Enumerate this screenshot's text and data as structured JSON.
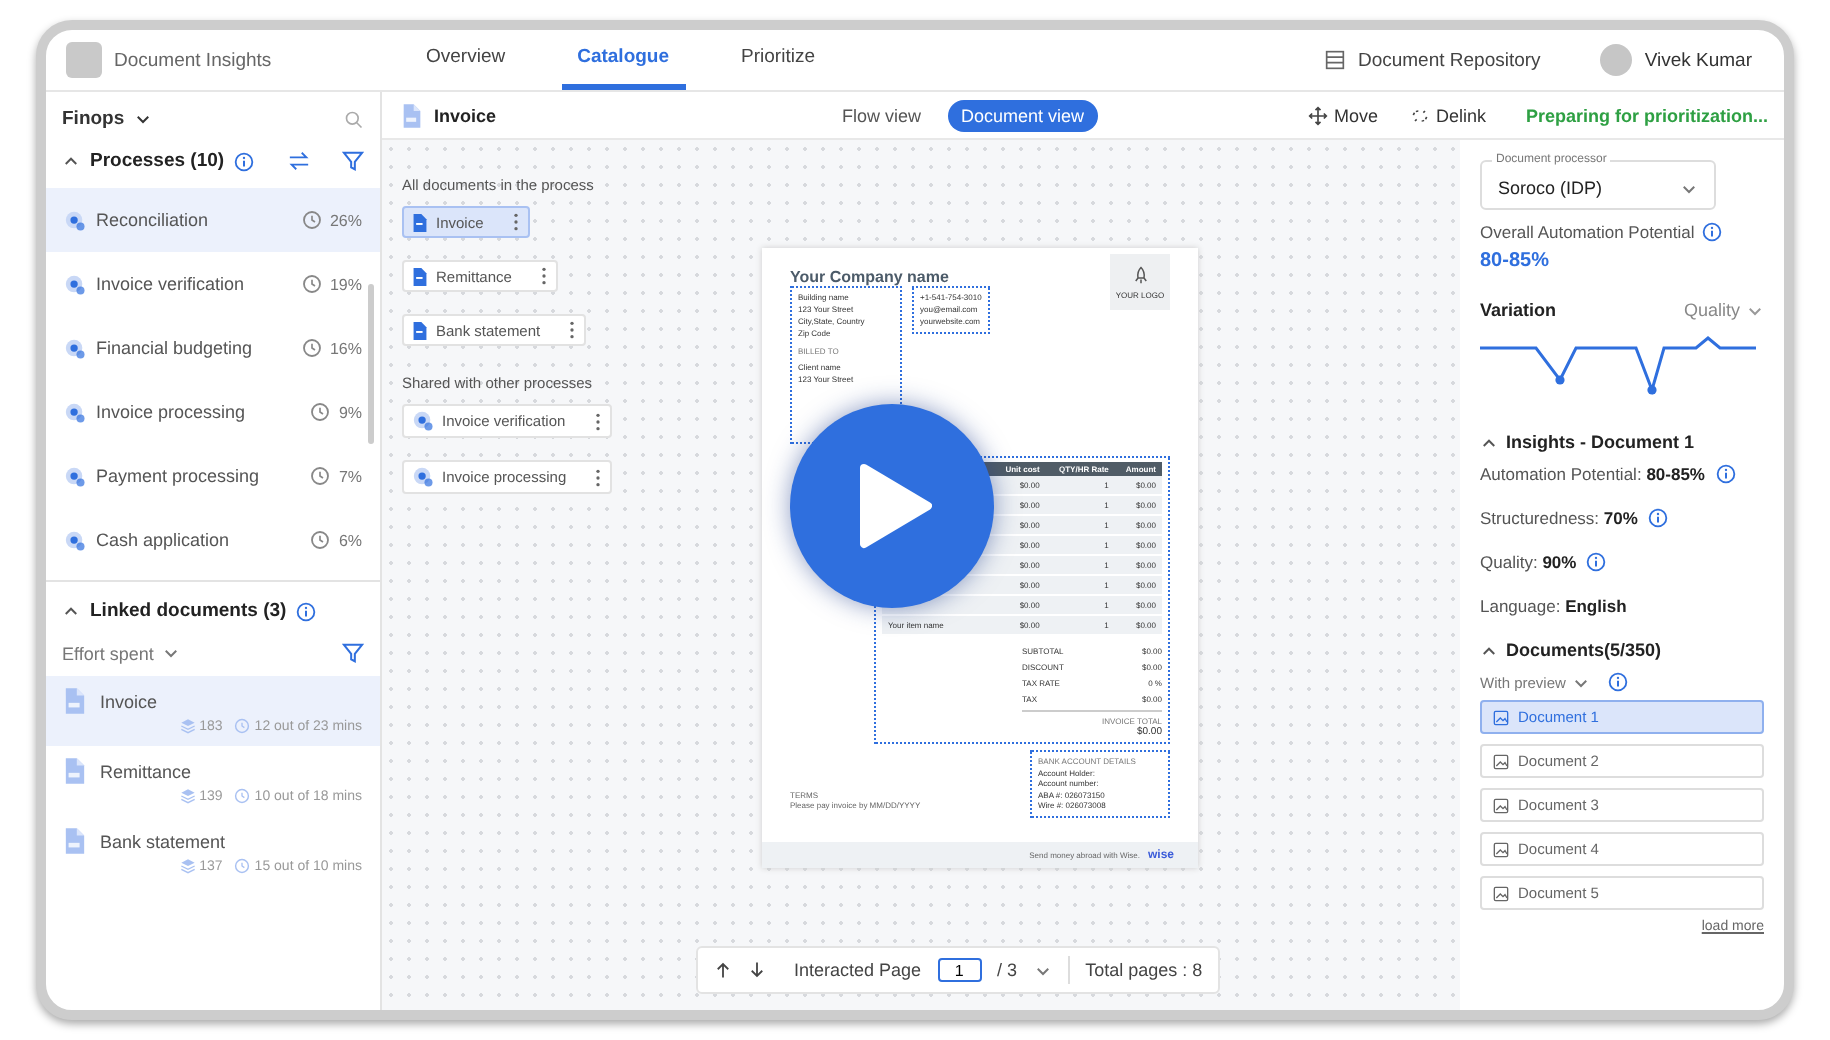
{
  "app": {
    "title": "Document Insights"
  },
  "nav_tabs": [
    {
      "label": "Overview",
      "selected": false
    },
    {
      "label": "Catalogue",
      "selected": true
    },
    {
      "label": "Prioritize",
      "selected": false
    }
  ],
  "repository_link": "Document Repository",
  "user": {
    "name": "Vivek Kumar"
  },
  "sidebar": {
    "workspace": "Finops",
    "processes": {
      "title": "Processes (10)",
      "expanded": true,
      "items": [
        {
          "name": "Reconciliation",
          "share": "26%",
          "selected": true
        },
        {
          "name": "Invoice verification",
          "share": "19%",
          "selected": false
        },
        {
          "name": "Financial budgeting",
          "share": "16%",
          "selected": false
        },
        {
          "name": "Invoice processing",
          "share": "9%",
          "selected": false
        },
        {
          "name": "Payment processing",
          "share": "7%",
          "selected": false
        },
        {
          "name": "Cash application",
          "share": "6%",
          "selected": false
        }
      ]
    },
    "linked_documents": {
      "title": "Linked documents (3)",
      "expanded": true,
      "sort": "Effort spent",
      "items": [
        {
          "name": "Invoice",
          "pages": "183",
          "effort": "12 out of 23 mins",
          "selected": true
        },
        {
          "name": "Remittance",
          "pages": "139",
          "effort": "10 out of 18 mins",
          "selected": false
        },
        {
          "name": "Bank statement",
          "pages": "137",
          "effort": "15 out of 10 mins",
          "selected": false
        }
      ]
    }
  },
  "toolbar": {
    "document": "Invoice",
    "views": [
      {
        "label": "Flow view",
        "selected": false
      },
      {
        "label": "Document view",
        "selected": true
      }
    ],
    "actions": [
      {
        "label": "Move",
        "kind": "move"
      },
      {
        "label": "Delink",
        "kind": "delink"
      }
    ],
    "status": "Preparing for prioritization..."
  },
  "canvas": {
    "groups": [
      {
        "title": "All documents in the process",
        "items": [
          {
            "label": "Invoice",
            "kind": "document",
            "selected": true
          },
          {
            "label": "Remittance",
            "kind": "document",
            "selected": false
          },
          {
            "label": "Bank statement",
            "kind": "document",
            "selected": false
          }
        ]
      },
      {
        "title": "Shared with other processes",
        "items": [
          {
            "label": "Invoice verification",
            "kind": "process",
            "selected": false
          },
          {
            "label": "Invoice processing",
            "kind": "process",
            "selected": false
          }
        ]
      }
    ]
  },
  "preview": {
    "company": "Your Company name",
    "address": [
      "Building name",
      "123 Your Street",
      "City,State, Country",
      "Zip Code"
    ],
    "contact": [
      "+1-541-754-3010",
      "you@email.com",
      "yourwebsite.com"
    ],
    "logo": "YOUR LOGO",
    "billed_to": {
      "title": "BILLED TO",
      "lines": [
        "Client name",
        "123 Your Street"
      ]
    },
    "table": {
      "columns": [
        "Unit cost",
        "QTY/HR Rate",
        "Amount"
      ],
      "rows": [
        {
          "unit_cost": "$0.00",
          "qty": "1",
          "amount": "$0.00"
        },
        {
          "unit_cost": "$0.00",
          "qty": "1",
          "amount": "$0.00"
        },
        {
          "unit_cost": "$0.00",
          "qty": "1",
          "amount": "$0.00"
        },
        {
          "unit_cost": "$0.00",
          "qty": "1",
          "amount": "$0.00"
        },
        {
          "unit_cost": "$0.00",
          "qty": "1",
          "amount": "$0.00"
        },
        {
          "unit_cost": "$0.00",
          "qty": "1",
          "amount": "$0.00"
        },
        {
          "unit_cost": "$0.00",
          "qty": "1",
          "amount": "$0.00"
        },
        {
          "item": "Your item name",
          "unit_cost": "$0.00",
          "qty": "1",
          "amount": "$0.00"
        }
      ]
    },
    "totals": [
      {
        "label": "SUBTOTAL",
        "value": "$0.00"
      },
      {
        "label": "DISCOUNT",
        "value": "$0.00"
      },
      {
        "label": "TAX RATE",
        "value": "0 %"
      },
      {
        "label": "TAX",
        "value": "$0.00"
      }
    ],
    "total": {
      "label": "INVOICE TOTAL",
      "value": "$0.00"
    },
    "bank": {
      "title": "BANK ACCOUNT DETAILS",
      "lines": [
        "Account Holder:",
        "Account number:",
        "ABA #: 026073150",
        "Wire #: 026073008"
      ]
    },
    "terms": {
      "title": "TERMS",
      "text": "Please pay invoice by MM/DD/YYYY"
    },
    "footer": {
      "text": "Send money abroad with Wise.",
      "brand": "wise"
    }
  },
  "pager": {
    "label": "Interacted Page",
    "page": "1",
    "of": "/ 3",
    "total": "Total pages : 8"
  },
  "right_panel": {
    "processor": {
      "label": "Document processor",
      "value": "Soroco (IDP)"
    },
    "potential_label": "Overall Automation Potential",
    "potential_value": "80-85%",
    "variation": {
      "title": "Variation",
      "metric": "Quality"
    },
    "insights": {
      "title": "Insights - Document 1",
      "expanded": true,
      "rows": [
        {
          "label": "Automation Potential:",
          "value": "80-85%",
          "info": true
        },
        {
          "label": "Structuredness:",
          "value": "70%",
          "info": true
        },
        {
          "label": "Quality:",
          "value": "90%",
          "info": true
        },
        {
          "label": "Language:",
          "value": "English",
          "info": false
        }
      ]
    },
    "documents": {
      "title": "Documents(5/350)",
      "expanded": true,
      "filter": "With preview",
      "items": [
        {
          "label": "Document 1",
          "selected": true
        },
        {
          "label": "Document 2",
          "selected": false
        },
        {
          "label": "Document 3",
          "selected": false
        },
        {
          "label": "Document 4",
          "selected": false
        },
        {
          "label": "Document 5",
          "selected": false
        }
      ],
      "load_more": "load more"
    }
  }
}
